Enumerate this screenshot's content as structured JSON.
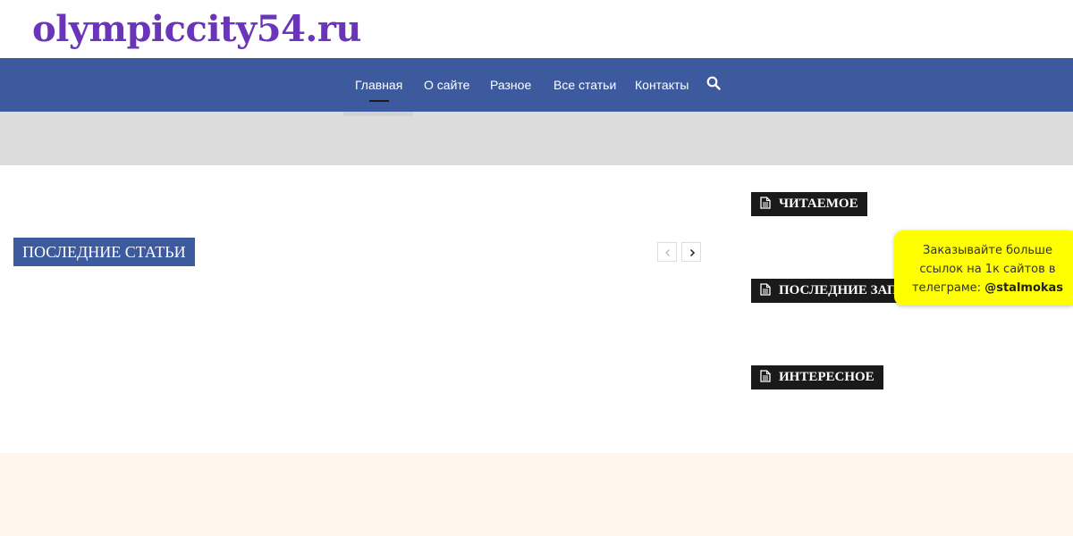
{
  "site": {
    "logo": "olympiccity54.ru"
  },
  "nav": {
    "items": [
      {
        "label": "Главная",
        "active": true
      },
      {
        "label": "О сайте"
      },
      {
        "label": "Разное"
      },
      {
        "label": "Все статьи"
      },
      {
        "label": "Контакты"
      }
    ],
    "search_icon": "search-icon"
  },
  "main": {
    "section_title": "ПОСЛЕДНИЕ СТАТЬИ",
    "prev_icon": "chevron-left-icon",
    "next_icon": "chevron-right-icon"
  },
  "sidebar": {
    "widgets": [
      {
        "title": "ЧИТАЕМОЕ",
        "icon": "document-icon"
      },
      {
        "title": "ПОСЛЕДНИЕ ЗАПИСИ",
        "icon": "document-icon"
      },
      {
        "title": "ИНТЕРЕСНОЕ",
        "icon": "document-icon"
      }
    ]
  },
  "promo": {
    "text": "Заказывайте больше ссылок на 1к сайтов в телеграме:",
    "handle": "@stalmokas"
  },
  "colors": {
    "brand": "#6a35b8",
    "navbar": "#3d5a9e",
    "widget_bg": "#1a1a1a",
    "promo_bg": "#ffff00",
    "footer_bg": "#fff7ee"
  }
}
